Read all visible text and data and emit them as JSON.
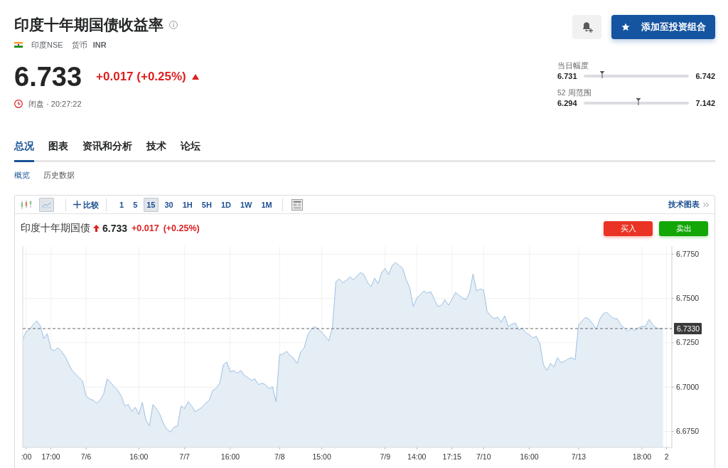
{
  "quote": {
    "title": "印度十年期国债收益率",
    "exchange": "印度NSE",
    "currency_label": "货币",
    "currency": "INR",
    "price": "6.733",
    "change": "+0.017 (+0.25%)",
    "rising": true,
    "market_status": "闭盘 · 20:27:22"
  },
  "portfolio_button": "添加至投资组合",
  "ranges": [
    {
      "label": "当日幅度",
      "low": "6.731",
      "high": "6.742",
      "level": 0.18
    },
    {
      "label": "52 周范围",
      "low": "6.294",
      "high": "7.142",
      "level": 0.52
    }
  ],
  "tabs": [
    {
      "label": "总况",
      "selected": true
    },
    {
      "label": "图表",
      "selected": false
    },
    {
      "label": "资讯和分析",
      "selected": false
    },
    {
      "label": "技术",
      "selected": false
    },
    {
      "label": "论坛",
      "selected": false
    }
  ],
  "subtabs": [
    {
      "label": "概览",
      "selected": true
    },
    {
      "label": "历史数据",
      "selected": false
    }
  ],
  "chart_panel": {
    "toolbar": {
      "chart_types": [
        {
          "kind": "candlestick",
          "selected": false
        },
        {
          "kind": "line",
          "selected": true
        }
      ],
      "compare": "比较",
      "intervals": [
        {
          "label": "1",
          "selected": false
        },
        {
          "label": "5",
          "selected": false
        },
        {
          "label": "15",
          "selected": true
        },
        {
          "label": "30",
          "selected": false
        },
        {
          "label": "1H",
          "selected": false
        },
        {
          "label": "5H",
          "selected": false
        },
        {
          "label": "1D",
          "selected": false
        },
        {
          "label": "1W",
          "selected": false
        },
        {
          "label": "1M",
          "selected": false
        }
      ],
      "link": "技术图表"
    },
    "legend": {
      "name": "印度十年期国债",
      "rising": true,
      "price": "6.733",
      "change": "+0.017",
      "percent": "(+0.25%)"
    },
    "trade_buttons": [
      {
        "kind": "buy",
        "label": "买入"
      },
      {
        "kind": "sell",
        "label": "卖出"
      }
    ],
    "chart_data": {
      "type": "area",
      "grid": true,
      "categories": [
        null,
        ":00",
        null,
        null,
        null,
        null,
        null,
        null,
        "17:00",
        null,
        null,
        null,
        null,
        null,
        null,
        null,
        null,
        null,
        "7/6",
        null,
        null,
        null,
        null,
        null,
        null,
        null,
        null,
        null,
        null,
        null,
        null,
        null,
        null,
        "16:00",
        null,
        null,
        null,
        null,
        null,
        null,
        null,
        null,
        null,
        null,
        null,
        null,
        "7/7",
        null,
        null,
        null,
        null,
        null,
        null,
        null,
        null,
        null,
        null,
        null,
        null,
        "16:00",
        null,
        null,
        null,
        null,
        null,
        null,
        null,
        null,
        null,
        null,
        null,
        null,
        null,
        "7/8",
        null,
        null,
        null,
        null,
        null,
        null,
        null,
        null,
        null,
        null,
        null,
        "15:00",
        null,
        null,
        null,
        null,
        null,
        null,
        null,
        null,
        null,
        null,
        null,
        null,
        null,
        null,
        null,
        null,
        null,
        "7/9",
        null,
        null,
        null,
        null,
        null,
        null,
        null,
        null,
        "14:00",
        null,
        null,
        null,
        null,
        null,
        null,
        null,
        null,
        null,
        "17:15",
        null,
        null,
        null,
        null,
        null,
        null,
        null,
        null,
        "7/10",
        null,
        null,
        null,
        null,
        null,
        null,
        null,
        null,
        null,
        null,
        null,
        null,
        "16:00",
        null,
        null,
        null,
        null,
        null,
        null,
        null,
        null,
        null,
        null,
        null,
        null,
        null,
        "7/13",
        null,
        null,
        null,
        null,
        null,
        null,
        null,
        null,
        null,
        null,
        null,
        null,
        null,
        null,
        null,
        null,
        null,
        "18:00",
        null,
        null,
        null,
        null,
        null,
        null,
        "2",
        null
      ],
      "values": [
        6.727,
        6.7314,
        6.7326,
        6.7354,
        6.7374,
        6.7346,
        6.7274,
        6.7302,
        6.7214,
        6.7206,
        6.7222,
        6.7202,
        6.7174,
        6.7134,
        6.7094,
        6.7074,
        6.7054,
        6.7034,
        6.695,
        6.6934,
        6.6926,
        6.691,
        6.6926,
        6.6962,
        6.7046,
        6.7026,
        6.7002,
        6.6982,
        6.695,
        6.6894,
        6.6902,
        6.6862,
        6.6886,
        6.6846,
        6.6914,
        6.6814,
        6.6782,
        6.6902,
        6.6878,
        6.6846,
        6.6794,
        6.6762,
        6.6746,
        6.6774,
        6.6782,
        6.6894,
        6.6878,
        6.6918,
        6.6894,
        6.6862,
        6.6874,
        6.6886,
        6.691,
        6.6926,
        6.6982,
        6.6994,
        6.7022,
        6.7126,
        6.7142,
        6.7086,
        6.7094,
        6.7078,
        6.7094,
        6.7066,
        6.7054,
        6.7038,
        6.7046,
        6.7014,
        6.7022,
        6.7014,
        6.699,
        6.7002,
        6.6918,
        6.7182,
        6.7186,
        6.7202,
        6.7178,
        6.7162,
        6.7134,
        6.7198,
        6.7222,
        6.7294,
        6.7326,
        6.7342,
        6.7326,
        6.731,
        6.7286,
        6.7262,
        6.7334,
        6.7594,
        6.761,
        6.759,
        6.7602,
        6.7622,
        6.7606,
        6.7626,
        6.7646,
        6.7634,
        6.759,
        6.7566,
        6.7614,
        6.7582,
        6.7646,
        6.767,
        6.7634,
        6.7686,
        6.7702,
        6.7686,
        6.767,
        6.7606,
        6.7562,
        6.7454,
        6.7502,
        6.7522,
        6.7542,
        6.753,
        6.7538,
        6.7494,
        6.7454,
        6.7462,
        6.7494,
        6.7462,
        6.7494,
        6.7534,
        6.7518,
        6.7502,
        6.7494,
        6.7534,
        6.7638,
        6.7542,
        6.7554,
        6.7546,
        6.7426,
        6.7402,
        6.7386,
        6.7394,
        6.7366,
        6.7402,
        6.7342,
        6.7354,
        6.7362,
        6.7322,
        6.7334,
        6.7306,
        6.7294,
        6.7278,
        6.7286,
        6.7246,
        6.7126,
        6.7094,
        6.7134,
        6.7114,
        6.7166,
        6.7138,
        6.7146,
        6.7158,
        6.7166,
        6.7154,
        6.735,
        6.7374,
        6.7394,
        6.7382,
        6.7358,
        6.7326,
        6.7382,
        6.7414,
        6.7422,
        6.7402,
        6.7386,
        6.7386,
        6.735,
        6.7334,
        6.7314,
        6.7334,
        6.7318,
        6.7334,
        6.7342,
        6.7342,
        6.7382,
        6.7354,
        6.7334,
        6.733,
        6.733,
        null,
        null
      ],
      "ylim": [
        6.666,
        6.7795
      ],
      "yticks": [
        {
          "value": 6.675,
          "label": "6.6750"
        },
        {
          "value": 6.7,
          "label": "6.7000"
        },
        {
          "value": 6.725,
          "label": "6.7250"
        },
        {
          "value": 6.75,
          "label": "6.7500"
        },
        {
          "value": 6.775,
          "label": "6.7750"
        }
      ],
      "ref_lines": [
        {
          "axis": "y",
          "value": 6.733,
          "label": "6.7330"
        }
      ]
    }
  }
}
